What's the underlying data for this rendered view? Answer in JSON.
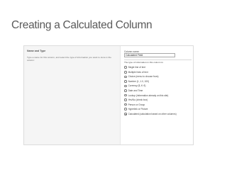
{
  "slide": {
    "title": "Creating a Calculated Column"
  },
  "section": {
    "heading": "Name and Type",
    "description": "Type a name for this column, and select the type of information you want to store in the column:"
  },
  "column_name": {
    "label": "Column name:",
    "value": "Calculated Field"
  },
  "type_field": {
    "label": "The type of information in this column is:",
    "options": [
      {
        "label": "Single line of text",
        "selected": false
      },
      {
        "label": "Multiple lines of text",
        "selected": false
      },
      {
        "label": "Choice (menu to choose from)",
        "selected": false
      },
      {
        "label": "Number (1, 1.0, 100)",
        "selected": false
      },
      {
        "label": "Currency ($, ¥, €)",
        "selected": false
      },
      {
        "label": "Date and Time",
        "selected": false
      },
      {
        "label": "Lookup (information already on this site)",
        "selected": false
      },
      {
        "label": "Yes/No (check box)",
        "selected": false
      },
      {
        "label": "Person or Group",
        "selected": false
      },
      {
        "label": "Hyperlink or Picture",
        "selected": false
      },
      {
        "label": "Calculated (calculation based on other columns)",
        "selected": true
      }
    ]
  }
}
